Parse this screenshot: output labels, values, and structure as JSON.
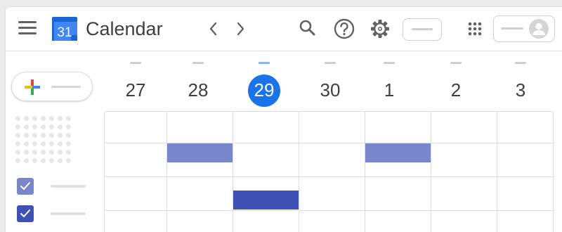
{
  "header": {
    "logo_day": "31",
    "app_title": "Calendar"
  },
  "week": {
    "days": [
      {
        "num": "27"
      },
      {
        "num": "28"
      },
      {
        "num": "29",
        "today": true
      },
      {
        "num": "30"
      },
      {
        "num": "1"
      },
      {
        "num": "2"
      },
      {
        "num": "3"
      }
    ]
  },
  "colors": {
    "accent": "#1a73e8",
    "event_light": "#7986cb",
    "event_dark": "#3f51b5",
    "check_light": "#7986cb",
    "check_dark": "#3f51b5"
  },
  "icons": [
    "menu-icon",
    "calendar-logo-icon",
    "chevron-left-icon",
    "chevron-right-icon",
    "search-icon",
    "help-icon",
    "gear-icon",
    "apps-grid-icon",
    "avatar-icon",
    "plus-icon",
    "check-icon"
  ]
}
